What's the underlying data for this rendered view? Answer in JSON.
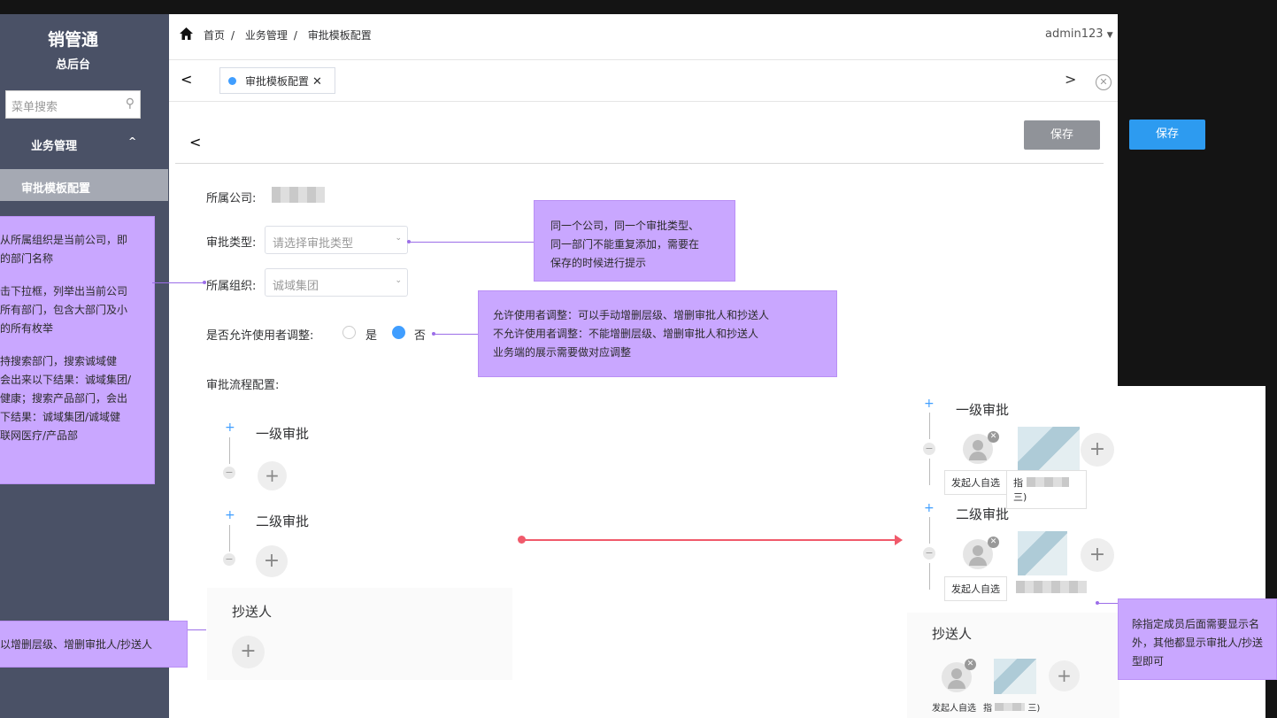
{
  "sidebar": {
    "logo": "销管通",
    "subtitle": "总后台",
    "search_placeholder": "菜单搜索",
    "group_label": "业务管理",
    "active_item": "审批模板配置"
  },
  "header": {
    "breadcrumb": [
      "首页",
      "业务管理",
      "审批模板配置"
    ],
    "separator": "/",
    "user": "admin123"
  },
  "tabs": {
    "active_tab": "审批模板配置",
    "close_glyph": "✕"
  },
  "form": {
    "save_label": "保存",
    "company_label": "所属公司:",
    "type_label": "审批类型:",
    "type_placeholder": "请选择审批类型",
    "org_label": "所属组织:",
    "org_value": "诚域集团",
    "adjust_label": "是否允许使用者调整:",
    "adjust_yes": "是",
    "adjust_no": "否",
    "adjust_selected": "否",
    "flow_label": "审批流程配置:"
  },
  "flow": {
    "level1": "一级审批",
    "level2": "二级审批",
    "cc": "抄送人"
  },
  "preview": {
    "level1": "一级审批",
    "level2": "二级审批",
    "cc": "抄送人",
    "self_select": "发起人自选",
    "designated_partial": "指",
    "designated_suffix": "三)",
    "save_label": "保存"
  },
  "notes": {
    "left1": [
      "从所属组织是当前公司，即",
      "的部门名称",
      "",
      "击下拉框，列举出当前公司",
      "所有部门，包含大部门及小",
      "的所有枚举",
      "",
      "持搜索部门，搜索诚域健",
      "会出来以下结果：诚域集团/",
      "健康；搜索产品部门，会出",
      "下结果：诚域集团/诚域健",
      "联网医疗/产品部"
    ],
    "left2": "以增删层级、增删审批人/抄送人",
    "type_note": [
      "同一个公司，同一个审批类型、",
      "同一部门不能重复添加，需要在",
      "保存的时候进行提示"
    ],
    "adjust_note": [
      "允许使用者调整：可以手动增删层级、增删审批人和抄送人",
      "不允许使用者调整：不能增删层级、增删审批人和抄送人",
      "业务端的展示需要做对应调整"
    ],
    "right_note": [
      "除指定成员后面需要显示名",
      "外，其他都显示审批人/抄送",
      "型即可"
    ]
  },
  "colors": {
    "sidebar_bg": "#4a5166",
    "note_bg": "#c9a7ff",
    "accent": "#409eff",
    "arrow": "#f05a6b"
  }
}
